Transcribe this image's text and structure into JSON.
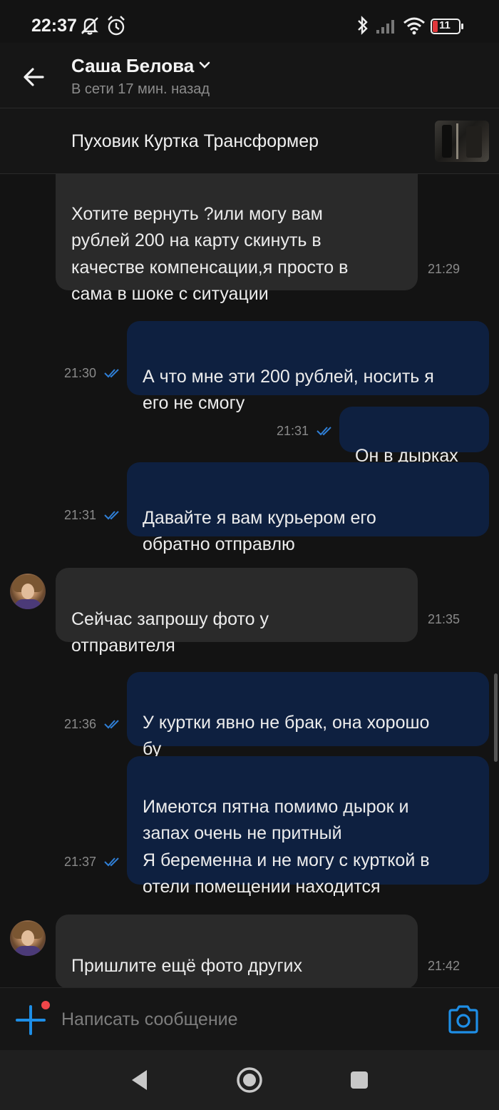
{
  "status_bar": {
    "time": "22:37",
    "battery": "11",
    "icons": [
      "mute-icon",
      "alarm-icon",
      "bluetooth-icon",
      "signal-icon",
      "wifi-icon",
      "battery-icon"
    ]
  },
  "header": {
    "contact_name": "Саша Белова",
    "contact_status": "В сети 17 мин. назад"
  },
  "item": {
    "title": "Пуховик Куртка Трансформер"
  },
  "messages": [
    {
      "direction": "incoming",
      "text": "Хотите вернуть ?или могу вам\nрублей 200 на карту скинуть в\nкачестве компенсации,я просто в\nсама в шоке с ситуации",
      "time": "21:29"
    },
    {
      "direction": "outgoing",
      "text": "А что мне эти 200 рублей, носить я\nего не смогу",
      "time": "21:30",
      "read": true
    },
    {
      "direction": "outgoing",
      "text": "Он в дырках",
      "time": "21:31",
      "read": true
    },
    {
      "direction": "outgoing",
      "text": "Давайте я вам курьером его\nобратно отправлю",
      "time": "21:31",
      "read": true
    },
    {
      "direction": "incoming",
      "text": "Сейчас запрошу фото у\nотправителя",
      "time": "21:35"
    },
    {
      "direction": "outgoing",
      "text": "У куртки явно не брак, она хорошо\nбу",
      "time": "21:36",
      "read": true
    },
    {
      "direction": "outgoing",
      "text": "Имеются пятна помимо дырок и\nзапах очень не притный\nЯ беременна и не могу с курткой в\nотели помещении находится",
      "time": "21:37",
      "read": true
    },
    {
      "direction": "incoming",
      "text": "Пришлите ещё фото других\nдверок  для сравнения и пятен",
      "time": "21:42"
    }
  ],
  "composer": {
    "placeholder": "Написать сообщение"
  },
  "colors": {
    "background": "#131313",
    "incoming_bubble": "#2a2a2a",
    "outgoing_bubble": "#0e2040",
    "accent": "#1e8ee6",
    "notification_dot": "#f0464a"
  }
}
